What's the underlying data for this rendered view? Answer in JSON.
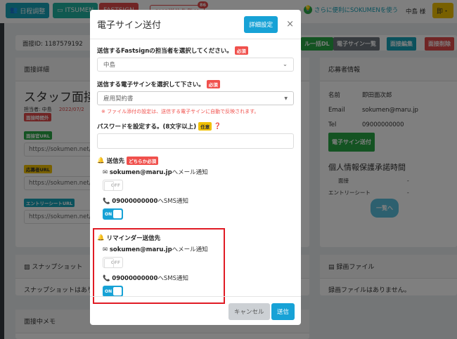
{
  "topbar": {
    "schedule": "日程調整",
    "itsumen": "ITSUMEN",
    "fastsign": "FASTSIGN",
    "sms": "SMS送信失敗(1",
    "sms_count": "86",
    "tip": "さらに便利にSOKUMENを使う",
    "user": "中島 様",
    "instant": "即・"
  },
  "page": {
    "interview_id": "面接ID: 1187579192",
    "actions": [
      "ル一括DL",
      "電子サイン一覧",
      "面接編集",
      "面接削除"
    ],
    "detail_title": "面接詳細",
    "interview_name": "スタッフ面接",
    "owner": "担当者: 中島",
    "date": "2022/07/2",
    "outside_badge": "面接時間外",
    "interviewer_url_label": "面接官URL",
    "interviewer_url": "https://sokumen.net/in",
    "applicant_url_label": "応募者URL",
    "applicant_url": "https://sokumen.net/in",
    "entry_url_label": "エントリーシートURL",
    "entry_url": "https://sokumen.net/en",
    "snapshot_title": "スナップショット",
    "snapshot_empty": "スナップショットはあり",
    "memo_title": "面接中メモ",
    "applicant_title": "応募者情報",
    "name_label": "名前",
    "name": "即田面次郎",
    "email_label": "Email",
    "email": "sokumen@maru.jp",
    "tel_label": "Tel",
    "tel": "09000000000",
    "esign_button": "電子サイン送付",
    "privacy_title": "個人情報保護承諾時間",
    "privacy_rows": [
      {
        "k": "面接",
        "v": "-"
      },
      {
        "k": "エントリーシート",
        "v": "-"
      }
    ],
    "list_button": "一覧へ",
    "recording_title": "録画ファイル",
    "recording_empty": "録画ファイルはありません。"
  },
  "modal": {
    "title": "電子サイン送付",
    "detail_button": "詳細設定",
    "close": "×",
    "assignee_label": "送信するFastsignの担当者を選択してください。",
    "required": "必須",
    "assignee_value": "中島",
    "esign_label": "送信する電子サインを選択して下さい。",
    "esign_value": "雇用契約書",
    "note": "※ ファイル添付の設定は、送信する電子サインに自動で反映されます。",
    "password_label": "パスワードを設定する。(8文字以上)",
    "optional": "任意",
    "password_value": "",
    "dest_title": "送信先",
    "either_required": "どちらか必須",
    "email": "sokumen@maru.jp",
    "email_suffix": "へメール通知",
    "tel": "09000000000",
    "sms_suffix": "へSMS通知",
    "dest_email_on": false,
    "dest_sms_on": true,
    "reminder_title": "リマインダー送信先",
    "reminder_email_on": false,
    "reminder_sms_on": true,
    "off": "OFF",
    "on": "ON",
    "cancel": "キャンセル",
    "send": "送信"
  },
  "colors": {
    "accent": "#17a2d6",
    "danger": "#f0504c",
    "success": "#28a745",
    "highlight": "#e01b24"
  }
}
